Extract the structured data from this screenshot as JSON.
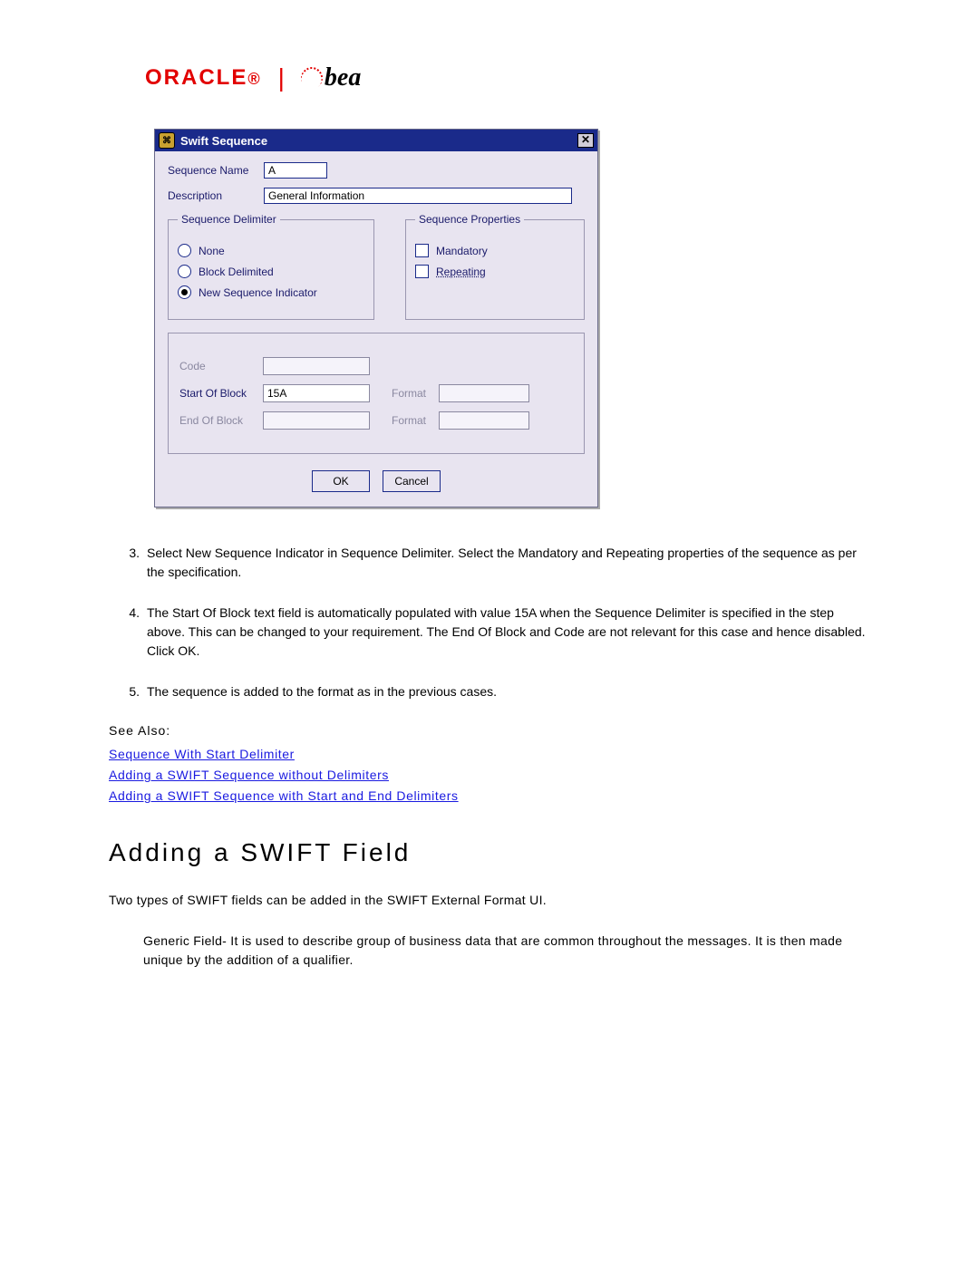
{
  "logo": {
    "oracle": "ORACLE",
    "bea": "bea"
  },
  "dialog": {
    "title": "Swift Sequence",
    "seq_name_label": "Sequence Name",
    "seq_name_value": "A",
    "desc_label": "Description",
    "desc_value": "General Information",
    "delimiter_legend": "Sequence Delimiter",
    "delimiter_none": "None",
    "delimiter_block": "Block Delimited",
    "delimiter_new": "New Sequence Indicator",
    "props_legend": "Sequence Properties",
    "prop_mandatory": "Mandatory",
    "prop_repeating": "Repeating",
    "code_label": "Code",
    "start_label": "Start Of Block",
    "start_value": "15A",
    "end_label": "End Of Block",
    "format_label": "Format",
    "ok": "OK",
    "cancel": "Cancel"
  },
  "steps": {
    "s3_num": "3.",
    "s3": "Select New Sequence Indicator in Sequence Delimiter. Select the Mandatory and Repeating properties of the sequence as per the specification.",
    "s4_num": "4.",
    "s4": "The Start Of Block text field is automatically populated with value 15A when the Sequence Delimiter is specified in the step above. This can be changed to your requirement. The End Of Block and Code are not relevant for this case and hence disabled. Click OK.",
    "s5_num": "5.",
    "s5": "The sequence is added to the format as in the previous cases."
  },
  "see_also": "See Also:",
  "links": {
    "l1": "Sequence With Start Delimiter",
    "l2": "Adding a SWIFT Sequence without Delimiters",
    "l3": "Adding a SWIFT Sequence with Start and End Delimiters"
  },
  "heading": "Adding a SWIFT Field",
  "intro": "Two types of SWIFT fields can be added in the SWIFT External Format UI.",
  "generic": "Generic Field- It is used to describe group of business data that are common throughout the messages. It is then made unique by the addition of a qualifier."
}
